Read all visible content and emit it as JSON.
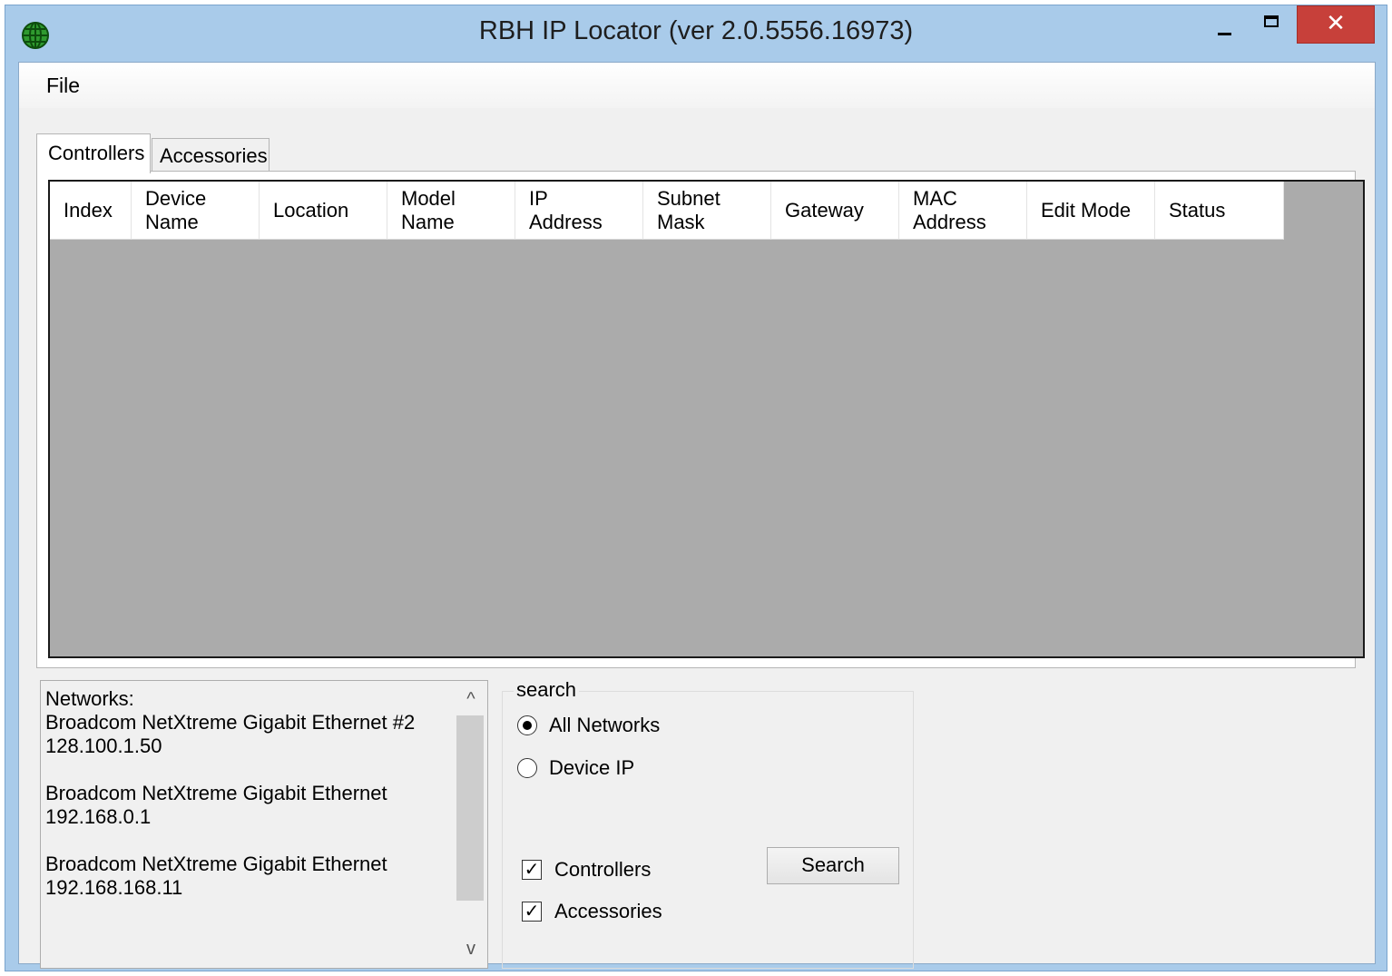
{
  "window": {
    "title": "RBH IP Locator (ver 2.0.5556.16973)",
    "close_glyph": "✕",
    "icon": "globe-icon"
  },
  "menu": {
    "file": "File"
  },
  "tabs": [
    {
      "label": "Controllers",
      "active": true
    },
    {
      "label": "Accessories",
      "active": false
    }
  ],
  "grid": {
    "columns": [
      "Index",
      "Device\nName",
      "Location",
      "Model\nName",
      "IP\nAddress",
      "Subnet\nMask",
      "Gateway",
      "MAC\nAddress",
      "Edit Mode",
      "Status"
    ],
    "rows": [],
    "background_color": "#ababab"
  },
  "networks": {
    "text": "Networks:\nBroadcom NetXtreme Gigabit Ethernet #2\n128.100.1.50\n\nBroadcom NetXtreme Gigabit Ethernet\n192.168.0.1\n\nBroadcom NetXtreme Gigabit Ethernet\n192.168.168.11",
    "scroll_up": "^",
    "scroll_down": "v"
  },
  "search": {
    "group_label": "search",
    "radio_all_networks": "All Networks",
    "radio_device_ip": "Device IP",
    "selected_radio": "All Networks",
    "check_controllers": "Controllers",
    "check_accessories": "Accessories",
    "controllers_checked": true,
    "accessories_checked": true,
    "check_glyph": "✓",
    "button": "Search"
  },
  "colors": {
    "titlebar": "#a9cbea",
    "close": "#c7403a",
    "client": "#f0f0f0"
  }
}
